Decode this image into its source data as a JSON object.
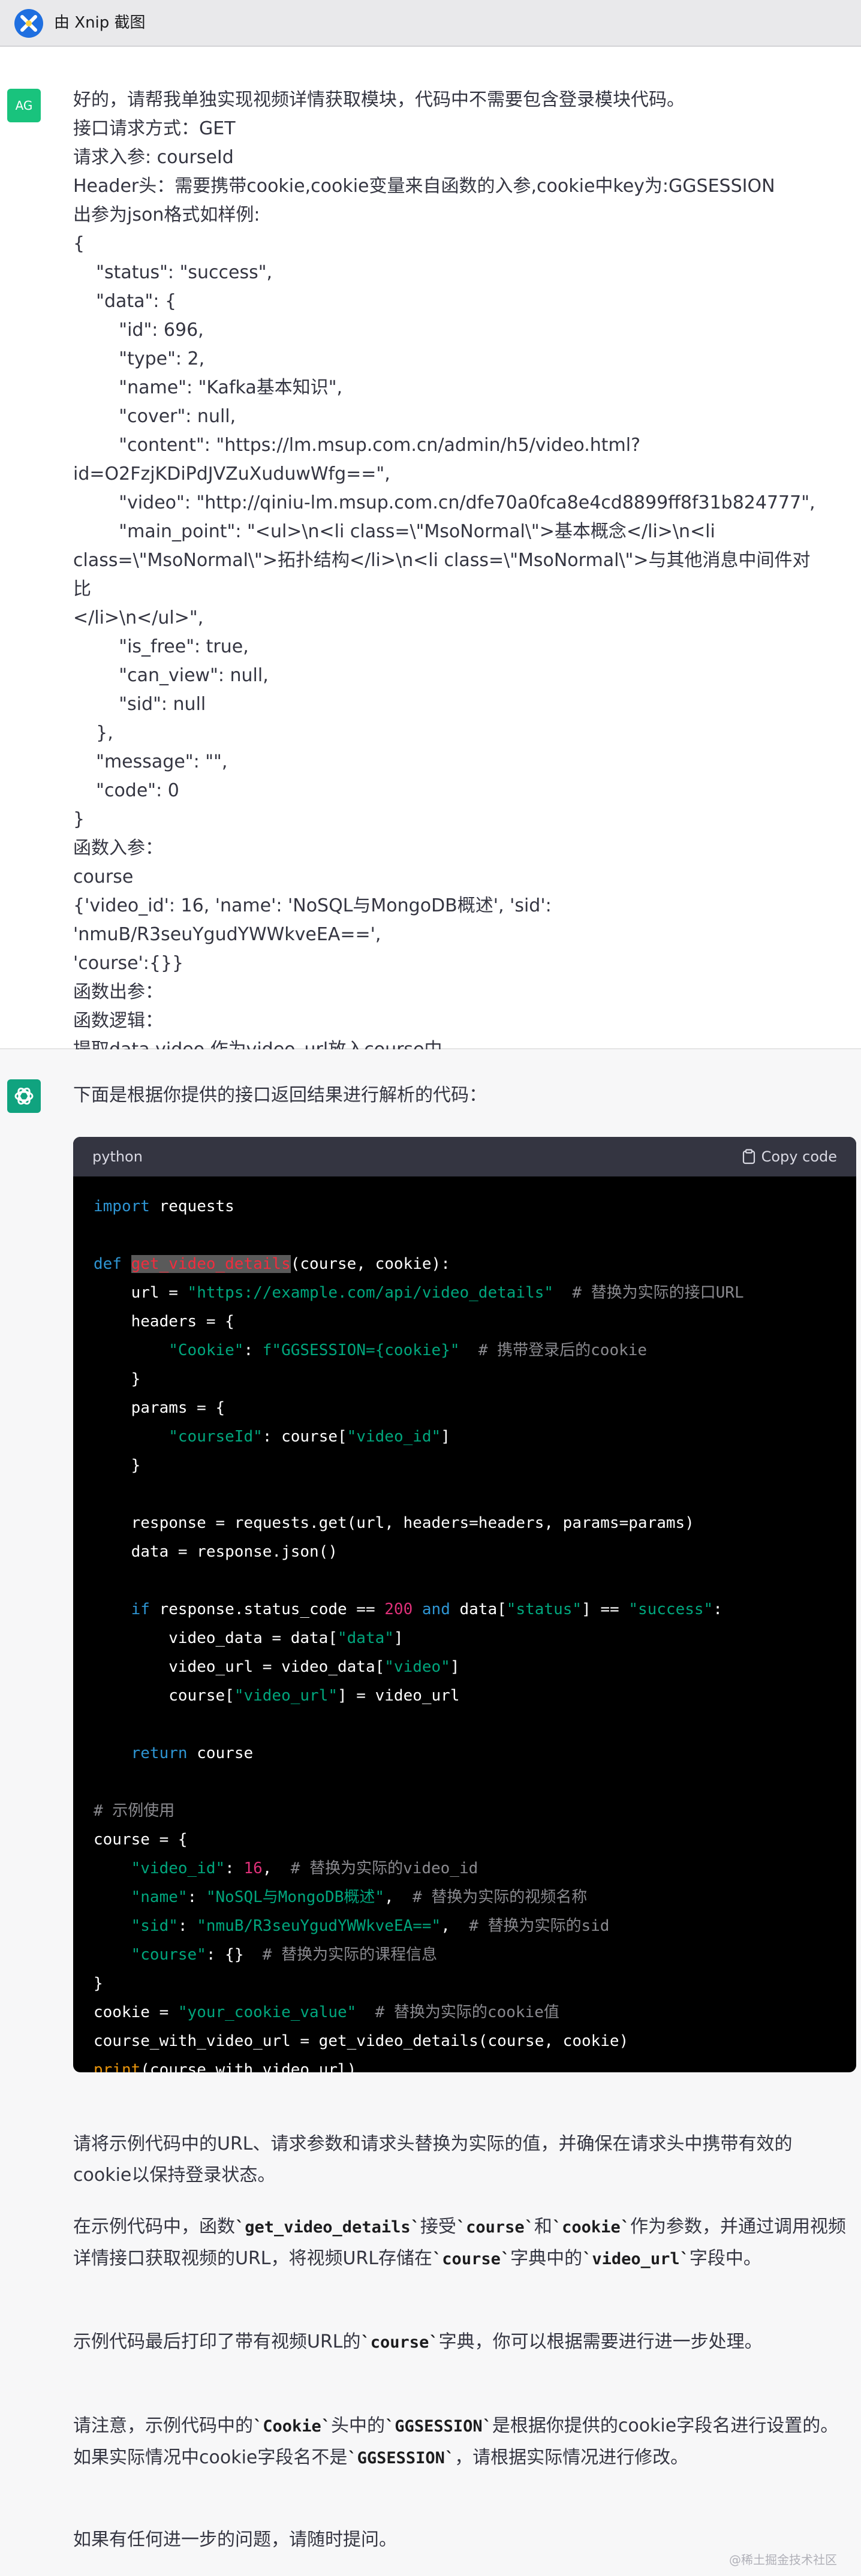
{
  "window": {
    "title": "由 Xnip 截图",
    "logo_icon": "xnip-logo-icon"
  },
  "user_message": {
    "avatar": "AG",
    "text": "好的，请帮我单独实现视频详情获取模块，代码中不需要包含登录模块代码。\n接口请求方式：GET\n请求入参: courseId\nHeader头：需要携带cookie,cookie变量来自函数的入参,cookie中key为:GGSESSION\n出参为json格式如样例:\n{\n    \"status\": \"success\",\n    \"data\": {\n        \"id\": 696,\n        \"type\": 2,\n        \"name\": \"Kafka基本知识\",\n        \"cover\": null,\n        \"content\": \"https://lm.msup.com.cn/admin/h5/video.html?\nid=O2FzjKDiPdJVZuXuduwWfg==\",\n        \"video\": \"http://qiniu-lm.msup.com.cn/dfe70a0fca8e4cd8899ff8f31b824777\",\n        \"main_point\": \"<ul>\\n<li class=\\\"MsoNormal\\\">基本概念</li>\\n<li\nclass=\\\"MsoNormal\\\">拓扑结构</li>\\n<li class=\\\"MsoNormal\\\">与其他消息中间件对比\n</li>\\n</ul>\",\n        \"is_free\": true,\n        \"can_view\": null,\n        \"sid\": null\n    },\n    \"message\": \"\",\n    \"code\": 0\n}\n函数入参：\ncourse\n{'video_id': 16, 'name': 'NoSQL与MongoDB概述', 'sid': 'nmuB/R3seuYgudYWWkveEA==',\n'course':{}}\n函数出参：\n函数逻辑：\n提取data.video 作为video_url放入course中"
  },
  "assistant_message": {
    "intro": "下面是根据你提供的接口返回结果进行解析的代码：",
    "code_block": {
      "language": "python",
      "copy_label": "Copy code",
      "copy_icon": "clipboard-icon",
      "lines": [
        [
          {
            "t": "import",
            "c": "kw"
          },
          {
            "t": " requests"
          }
        ],
        [],
        [
          {
            "t": "def",
            "c": "kw"
          },
          {
            "t": " "
          },
          {
            "t": "get_video_details",
            "c": "fn"
          },
          {
            "t": "(course, cookie):"
          }
        ],
        [
          {
            "t": "    url = "
          },
          {
            "t": "\"https://example.com/api/video_details\"",
            "c": "str"
          },
          {
            "t": "  "
          },
          {
            "t": "# 替换为实际的接口URL",
            "c": "cm"
          }
        ],
        [
          {
            "t": "    headers = {"
          }
        ],
        [
          {
            "t": "        "
          },
          {
            "t": "\"Cookie\"",
            "c": "str"
          },
          {
            "t": ": "
          },
          {
            "t": "f\"GGSESSION={cookie}\"",
            "c": "str"
          },
          {
            "t": "  "
          },
          {
            "t": "# 携带登录后的cookie",
            "c": "cm"
          }
        ],
        [
          {
            "t": "    }"
          }
        ],
        [
          {
            "t": "    params = {"
          }
        ],
        [
          {
            "t": "        "
          },
          {
            "t": "\"courseId\"",
            "c": "str"
          },
          {
            "t": ": course["
          },
          {
            "t": "\"video_id\"",
            "c": "str"
          },
          {
            "t": "]"
          }
        ],
        [
          {
            "t": "    }"
          }
        ],
        [],
        [
          {
            "t": "    response = requests.get(url, headers=headers, params=params)"
          }
        ],
        [
          {
            "t": "    data = response.json()"
          }
        ],
        [],
        [
          {
            "t": "    "
          },
          {
            "t": "if",
            "c": "kw"
          },
          {
            "t": " response.status_code == "
          },
          {
            "t": "200",
            "c": "num"
          },
          {
            "t": " "
          },
          {
            "t": "and",
            "c": "kw"
          },
          {
            "t": " data["
          },
          {
            "t": "\"status\"",
            "c": "str"
          },
          {
            "t": "] == "
          },
          {
            "t": "\"success\"",
            "c": "str"
          },
          {
            "t": ":"
          }
        ],
        [
          {
            "t": "        video_data = data["
          },
          {
            "t": "\"data\"",
            "c": "str"
          },
          {
            "t": "]"
          }
        ],
        [
          {
            "t": "        video_url = video_data["
          },
          {
            "t": "\"video\"",
            "c": "str"
          },
          {
            "t": "]"
          }
        ],
        [
          {
            "t": "        course["
          },
          {
            "t": "\"video_url\"",
            "c": "str"
          },
          {
            "t": "] = video_url"
          }
        ],
        [],
        [
          {
            "t": "    "
          },
          {
            "t": "return",
            "c": "kw"
          },
          {
            "t": " course"
          }
        ],
        [],
        [
          {
            "t": "# 示例使用",
            "c": "cm"
          }
        ],
        [
          {
            "t": "course = {"
          }
        ],
        [
          {
            "t": "    "
          },
          {
            "t": "\"video_id\"",
            "c": "str"
          },
          {
            "t": ": "
          },
          {
            "t": "16",
            "c": "num"
          },
          {
            "t": ",  "
          },
          {
            "t": "# 替换为实际的video_id",
            "c": "cm"
          }
        ],
        [
          {
            "t": "    "
          },
          {
            "t": "\"name\"",
            "c": "str"
          },
          {
            "t": ": "
          },
          {
            "t": "\"NoSQL与MongoDB概述\"",
            "c": "str"
          },
          {
            "t": ",  "
          },
          {
            "t": "# 替换为实际的视频名称",
            "c": "cm"
          }
        ],
        [
          {
            "t": "    "
          },
          {
            "t": "\"sid\"",
            "c": "str"
          },
          {
            "t": ": "
          },
          {
            "t": "\"nmuB/R3seuYgudYWWkveEA==\"",
            "c": "str"
          },
          {
            "t": ",  "
          },
          {
            "t": "# 替换为实际的sid",
            "c": "cm"
          }
        ],
        [
          {
            "t": "    "
          },
          {
            "t": "\"course\"",
            "c": "str"
          },
          {
            "t": ": {}  "
          },
          {
            "t": "# 替换为实际的课程信息",
            "c": "cm"
          }
        ],
        [
          {
            "t": "}"
          }
        ],
        [
          {
            "t": "cookie = "
          },
          {
            "t": "\"your_cookie_value\"",
            "c": "str"
          },
          {
            "t": "  "
          },
          {
            "t": "# 替换为实际的cookie值",
            "c": "cm"
          }
        ],
        [
          {
            "t": "course_with_video_url = get_video_details(course, cookie)"
          }
        ],
        [
          {
            "t": "print",
            "c": "bi"
          },
          {
            "t": "(course_with_video_url)"
          }
        ]
      ]
    },
    "paragraphs": [
      [
        {
          "t": "请将示例代码中的URL、请求参数和请求头替换为实际的值，并确保在请求头中携带有效的cookie以保持登录状态。"
        }
      ],
      [
        {
          "t": "在示例代码中，函数"
        },
        {
          "t": "`get_video_details`",
          "c": "code"
        },
        {
          "t": "接受"
        },
        {
          "t": "`course`",
          "c": "code"
        },
        {
          "t": "和"
        },
        {
          "t": "`cookie`",
          "c": "code"
        },
        {
          "t": "作为参数，并通过调用视频详情接口获取视频的URL，将视频URL存储在"
        },
        {
          "t": "`course`",
          "c": "code"
        },
        {
          "t": "字典中的"
        },
        {
          "t": "`video_url`",
          "c": "code"
        },
        {
          "t": "字段中。"
        }
      ],
      [
        {
          "t": "示例代码最后打印了带有视频URL的"
        },
        {
          "t": "`course`",
          "c": "code"
        },
        {
          "t": "字典，你可以根据需要进行进一步处理。"
        }
      ],
      [
        {
          "t": "请注意，示例代码中的"
        },
        {
          "t": "`Cookie`",
          "c": "code"
        },
        {
          "t": "头中的"
        },
        {
          "t": "`GGSESSION`",
          "c": "code"
        },
        {
          "t": "是根据你提供的cookie字段名进行设置的。如果实际情况中cookie字段名不是"
        },
        {
          "t": "`GGSESSION`",
          "c": "code"
        },
        {
          "t": "，请根据实际情况进行修改。"
        }
      ],
      [
        {
          "t": "如果有任何进一步的问题，请随时提问。"
        }
      ]
    ],
    "assistant_icon": "openai-logo-icon"
  },
  "watermark": "@稀土掘金技术社区"
}
